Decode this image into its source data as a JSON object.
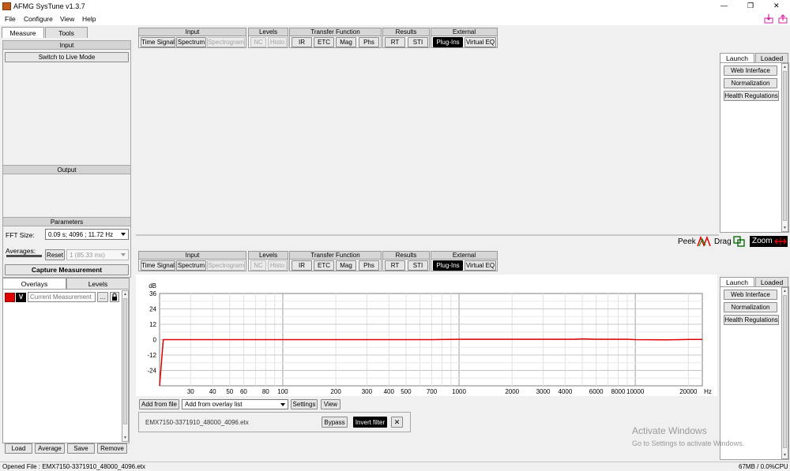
{
  "window": {
    "title": "AFMG SysTune v1.3.7",
    "controls": [
      "—",
      "❐",
      "✕"
    ]
  },
  "menu": [
    "File",
    "Configure",
    "View",
    "Help"
  ],
  "left_tabs": [
    "Measure",
    "Tools"
  ],
  "input_panel": {
    "title": "Input",
    "live_button": "Switch to Live Mode"
  },
  "output_panel": {
    "title": "Output"
  },
  "parameters": {
    "title": "Parameters",
    "fft_label": "FFT Size:",
    "fft_value": "0.09 s; 4096 ; 11.72 Hz",
    "averages_label": "Averages:",
    "reset": "Reset",
    "averages_value": "1 (85.33 ms)",
    "capture": "Capture Measurement"
  },
  "overlays": {
    "tabs": [
      "Overlays",
      "Levels"
    ],
    "v_label": "V",
    "name_placeholder": "Current Measurement",
    "more": "...",
    "buttons": [
      "Load",
      "Average",
      "Save",
      "Remove"
    ]
  },
  "toolbar": {
    "groups": [
      {
        "title": "Input",
        "buttons": [
          {
            "label": "Time Signal",
            "state": "normal"
          },
          {
            "label": "Spectrum",
            "state": "normal"
          },
          {
            "label": "Spectrogram",
            "state": "disabled"
          }
        ]
      },
      {
        "title": "Levels",
        "buttons": [
          {
            "label": "NC",
            "state": "disabled"
          },
          {
            "label": "Histo",
            "state": "disabled"
          }
        ]
      },
      {
        "title": "Transfer Function",
        "buttons": [
          {
            "label": "IR",
            "state": "normal"
          },
          {
            "label": "ETC",
            "state": "normal"
          },
          {
            "label": "Mag",
            "state": "normal"
          },
          {
            "label": "Phs",
            "state": "normal"
          }
        ]
      },
      {
        "title": "Results",
        "buttons": [
          {
            "label": "RT",
            "state": "normal"
          },
          {
            "label": "STI",
            "state": "normal"
          }
        ]
      },
      {
        "title": "External",
        "buttons": [
          {
            "label": "Plug-Ins",
            "state": "active"
          },
          {
            "label": "Virtual EQ",
            "state": "normal"
          }
        ]
      }
    ]
  },
  "launch_panel": {
    "tabs": [
      "Launch",
      "Loaded"
    ],
    "buttons": [
      "Web Interface",
      "Normalization",
      "Health Regulations"
    ]
  },
  "view_controls": {
    "peek": "Peek",
    "drag": "Drag",
    "zoom": "Zoom"
  },
  "chart_data": {
    "type": "line",
    "ylabel": "dB",
    "xunit": "Hz",
    "xscale": "log",
    "xlim": [
      20,
      24000
    ],
    "ylim": [
      -36,
      36
    ],
    "yticks": [
      36,
      24,
      12,
      0,
      -12,
      -24
    ],
    "xticks": [
      30,
      40,
      50,
      60,
      80,
      100,
      200,
      300,
      400,
      500,
      700,
      1000,
      2000,
      3000,
      4000,
      6000,
      8000,
      10000,
      20000
    ],
    "grid": true,
    "series": [
      {
        "color": "#e00000",
        "x": [
          20,
          21,
          100,
          700,
          1000,
          1200,
          3000,
          4500,
          5000,
          6000,
          9000,
          10000,
          15000,
          18000,
          20000,
          24000
        ],
        "y": [
          -36,
          0,
          0,
          0,
          0.3,
          0.3,
          0.3,
          0.3,
          0.6,
          0.3,
          0.3,
          0,
          -0.2,
          0,
          0.2,
          0.2
        ]
      }
    ]
  },
  "bottom_bar": {
    "add_from_file": "Add from file",
    "overlay_select": "Add from overlay list",
    "settings": "Settings",
    "view": "View"
  },
  "filter": {
    "file": "EMX7150-3371910_48000_4096.etx",
    "bypass": "Bypass",
    "invert": "Invert filter",
    "close": "✕"
  },
  "watermark": {
    "title": "Activate Windows",
    "sub": "Go to Settings to activate Windows."
  },
  "status": {
    "left": "Opened File : EMX7150-3371910_48000_4096.etx",
    "right": "67MB / 0.0%CPU"
  }
}
